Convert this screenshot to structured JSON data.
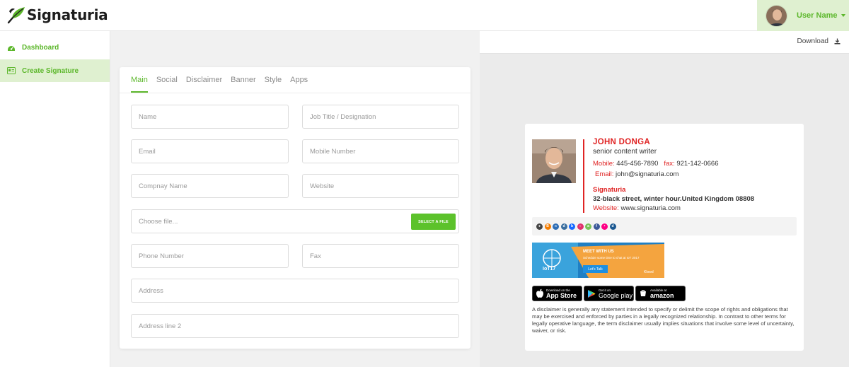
{
  "app": {
    "name": "Signaturia"
  },
  "user": {
    "name": "User Name"
  },
  "sidebar": {
    "items": [
      {
        "label": "Dashboard",
        "icon": "dashboard-icon"
      },
      {
        "label": "Create Signature",
        "icon": "id-card-icon"
      }
    ]
  },
  "editor": {
    "tabs": [
      "Main",
      "Social",
      "Disclaimer",
      "Banner",
      "Style",
      "Apps"
    ],
    "active_tab": "Main",
    "fields": {
      "name": "Name",
      "job_title": "Job Title / Designation",
      "email": "Email",
      "mobile": "Mobile Number",
      "company": "Compnay Name",
      "website": "Website",
      "file": "Choose file...",
      "file_button": "SELECT A FILE",
      "phone": "Phone Number",
      "fax": "Fax",
      "address": "Address",
      "address2": "Address line 2"
    }
  },
  "preview": {
    "download_label": "Download",
    "signature": {
      "name": "JOHN DONGA",
      "title": "senior content writer",
      "mobile_label": "Mobile:",
      "mobile": "445-456-7890",
      "fax_label": "fax:",
      "fax": "921-142-0666",
      "email_label": "Email:",
      "email": "john@signaturia.com",
      "company": "Signaturia",
      "address": "32-black street, winter hour.United Kingdom 08808",
      "website_label": "Website:",
      "website": "www.signaturia.com",
      "social_icons": [
        {
          "icon": "camera-icon",
          "color": "#444444"
        },
        {
          "icon": "blogger-icon",
          "color": "#f57d00"
        },
        {
          "icon": "link-icon",
          "color": "#2d6db5"
        },
        {
          "icon": "delicious-icon",
          "color": "#3a6e9f"
        },
        {
          "icon": "behance-icon",
          "color": "#1769ff"
        },
        {
          "icon": "instagram-icon",
          "color": "#e1306c"
        },
        {
          "icon": "android-icon",
          "color": "#78c257"
        },
        {
          "icon": "facebook-icon",
          "color": "#3b5998"
        },
        {
          "icon": "flickr-icon",
          "color": "#ff0084"
        },
        {
          "icon": "digg-icon",
          "color": "#1b5891"
        }
      ],
      "banner": {
        "brand": "IoT17",
        "heading": "MEET WITH US",
        "subtext": "Schedule some time to chat at IoT 2017",
        "button": "Let's Talk",
        "sponsor": "Klowd"
      },
      "stores": [
        {
          "small": "Download on the",
          "big": "App Store",
          "icon": "apple-icon"
        },
        {
          "small": "Get it on",
          "big": "Google play",
          "icon": "google-play-icon"
        },
        {
          "small": "Available at",
          "big": "amazon",
          "icon": "amazon-icon"
        }
      ],
      "disclaimer": "A disclaimer is generally any statement intended to specify or delimit the scope of rights and obligations that may be exercised and enforced by parties in a legally recognized relationship. In contrast to other terms for legally operative language, the term disclaimer usually implies situations that involve some level of uncertainty, waiver, or risk."
    }
  },
  "colors": {
    "accent": "#5cb72b",
    "accent_bg": "#dff0d0",
    "signature_red": "#e02424"
  }
}
